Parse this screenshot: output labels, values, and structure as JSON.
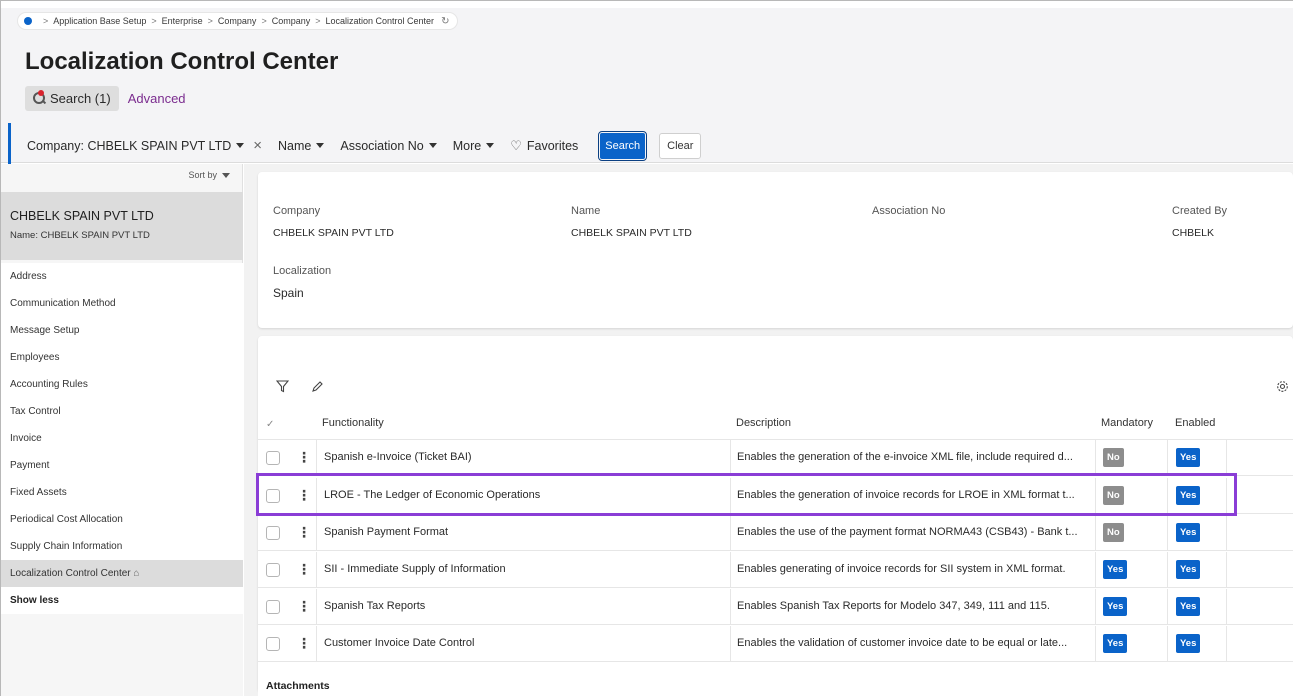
{
  "breadcrumb": {
    "items": [
      "Application Base Setup",
      "Enterprise",
      "Company",
      "Company",
      "Localization Control Center"
    ],
    "separator": ">"
  },
  "page_title": "Localization Control Center",
  "search": {
    "pill_label": "Search (1)",
    "advanced_label": "Advanced"
  },
  "filters": {
    "company": "Company: CHBELK SPAIN PVT LTD",
    "name": "Name",
    "association_no": "Association No",
    "more": "More",
    "favorites": "Favorites",
    "search_button": "Search",
    "clear_button": "Clear"
  },
  "sidebar": {
    "sort_by": "Sort by",
    "selected": {
      "title": "CHBELK SPAIN PVT LTD",
      "subtitle": "Name:  CHBELK SPAIN PVT LTD"
    },
    "items": [
      {
        "label": "Address"
      },
      {
        "label": "Communication Method"
      },
      {
        "label": "Message Setup"
      },
      {
        "label": "Employees"
      },
      {
        "label": "Accounting Rules"
      },
      {
        "label": "Tax Control"
      },
      {
        "label": "Invoice"
      },
      {
        "label": "Payment"
      },
      {
        "label": "Fixed Assets"
      },
      {
        "label": "Periodical Cost Allocation"
      },
      {
        "label": "Supply Chain Information"
      },
      {
        "label": "Localization Control Center"
      },
      {
        "label": "Show less"
      }
    ]
  },
  "detail": {
    "company_label": "Company",
    "company_value": "CHBELK SPAIN PVT LTD",
    "name_label": "Name",
    "name_value": "CHBELK SPAIN PVT LTD",
    "association_label": "Association No",
    "association_value": "",
    "created_by_label": "Created By",
    "created_by_value": "CHBELK",
    "localization_label": "Localization",
    "localization_value": "Spain"
  },
  "table": {
    "columns": {
      "functionality": "Functionality",
      "description": "Description",
      "mandatory": "Mandatory",
      "enabled": "Enabled"
    },
    "rows": [
      {
        "functionality": "Spanish e-Invoice (Ticket BAI)",
        "description": "Enables the generation of the e-invoice XML file, include required d...",
        "mandatory": "No",
        "enabled": "Yes"
      },
      {
        "functionality": "LROE - The Ledger of Economic Operations",
        "description": "Enables the generation of invoice records for LROE in XML format t...",
        "mandatory": "No",
        "enabled": "Yes"
      },
      {
        "functionality": "Spanish Payment Format",
        "description": "Enables the use of the payment format NORMA43 (CSB43) - Bank t...",
        "mandatory": "No",
        "enabled": "Yes"
      },
      {
        "functionality": "SII - Immediate Supply of Information",
        "description": "Enables generating of invoice records for SII system in XML format.",
        "mandatory": "Yes",
        "enabled": "Yes"
      },
      {
        "functionality": "Spanish Tax Reports",
        "description": "Enables Spanish Tax Reports for Modelo 347, 349, 111 and 115.",
        "mandatory": "Yes",
        "enabled": "Yes"
      },
      {
        "functionality": "Customer Invoice Date Control",
        "description": "Enables the validation of customer invoice date to be equal or late...",
        "mandatory": "Yes",
        "enabled": "Yes"
      }
    ]
  },
  "attachments_label": "Attachments",
  "icons": {
    "filter": "filter-icon",
    "edit": "pencil-icon",
    "settings": "gear-icon",
    "refresh": "refresh-icon",
    "pin": "pin-icon",
    "heart": "heart-icon"
  },
  "colors": {
    "accent": "#0a63c9",
    "highlight": "#8a3dd6",
    "advanced_link": "#7b2c8f",
    "badge_no": "#8d8d8d"
  }
}
